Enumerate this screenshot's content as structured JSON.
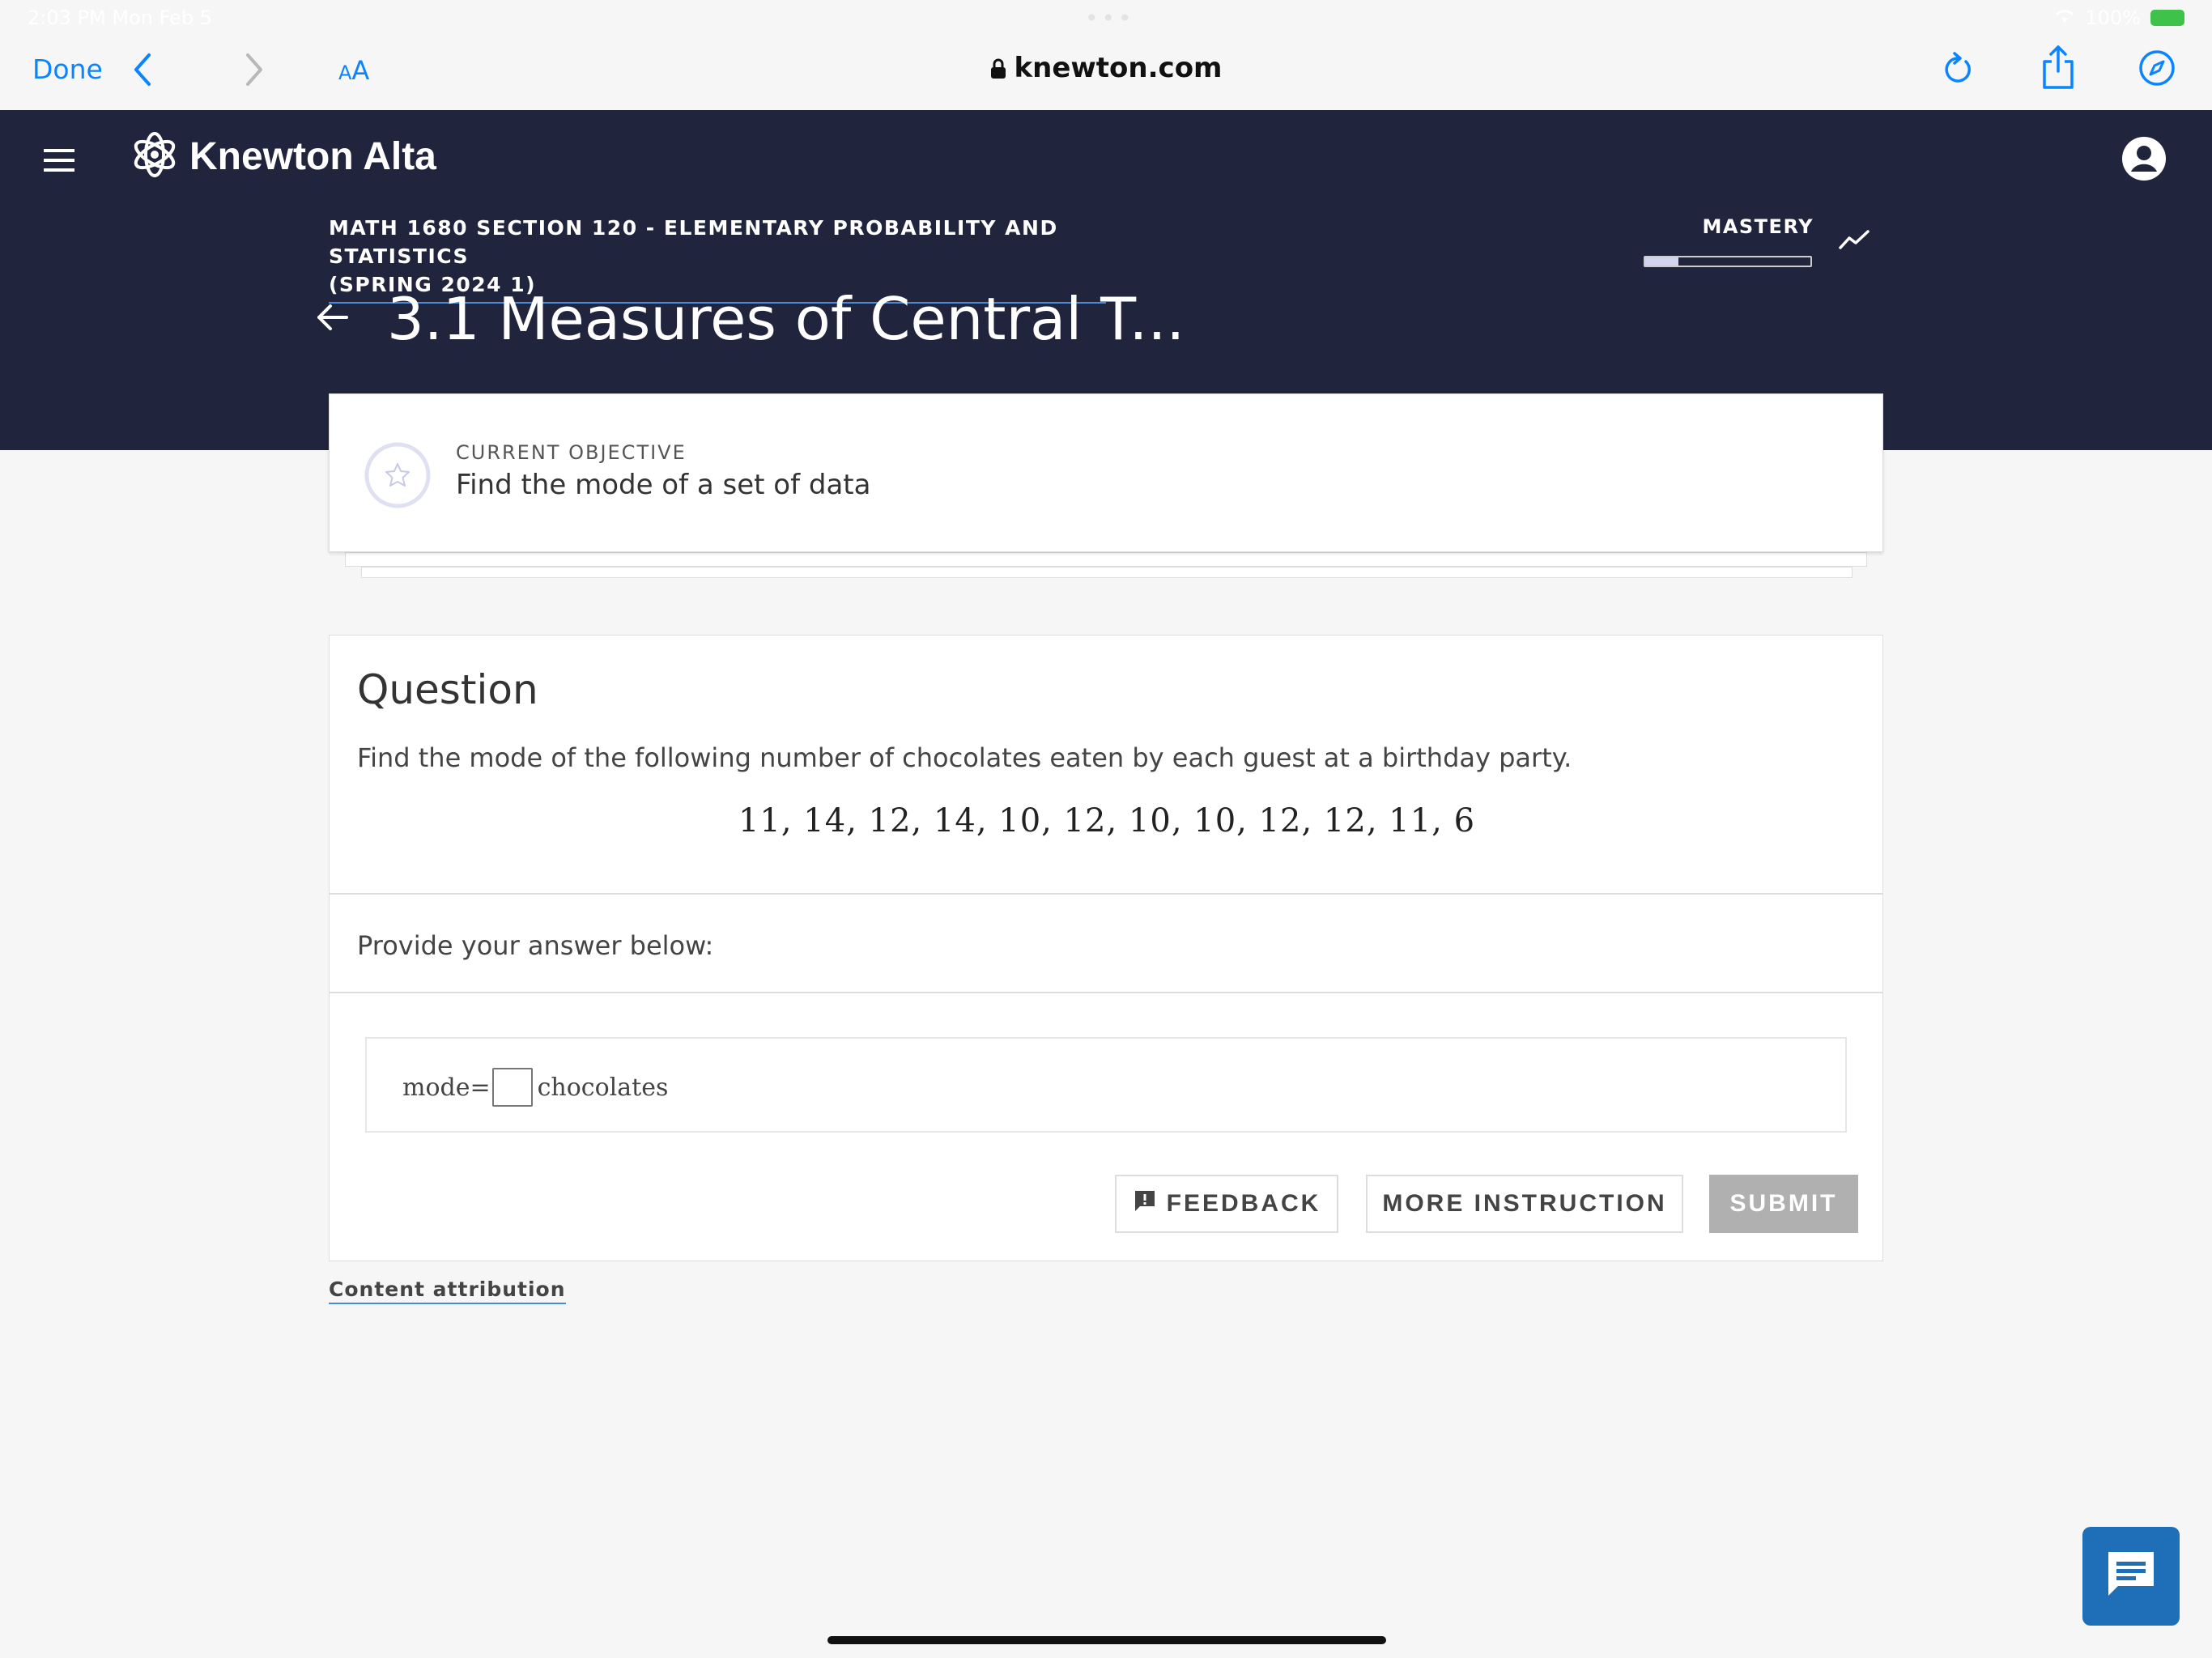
{
  "status": {
    "time": "2:03 PM  Mon Feb 5",
    "battery": "100%"
  },
  "browser": {
    "done_label": "Done",
    "aa_small": "A",
    "aa_large": "A",
    "url": "knewton.com"
  },
  "app": {
    "brand": "Knewton Alta"
  },
  "course": {
    "title_line1": "MATH 1680 SECTION 120 - ELEMENTARY PROBABILITY AND STATISTICS",
    "title_line2": "(SPRING 2024 1)",
    "mastery_label": "MASTERY",
    "mastery_progress": 0.2
  },
  "page": {
    "title": "3.1 Measures of Central T..."
  },
  "objective": {
    "label": "CURRENT OBJECTIVE",
    "text": "Find the mode of a set of data"
  },
  "question": {
    "heading": "Question",
    "text": "Find the mode of the following number of chocolates eaten by each guest at a birthday party.",
    "data": "11, 14, 12, 14, 10, 12, 10, 10, 12, 12, 11, 6",
    "provide_label": "Provide your answer below:",
    "answer_prefix": "mode=",
    "answer_value": "",
    "answer_suffix": "chocolates"
  },
  "buttons": {
    "feedback": "FEEDBACK",
    "more_instruction": "MORE INSTRUCTION",
    "submit": "SUBMIT"
  },
  "footer": {
    "attribution": "Content attribution"
  }
}
